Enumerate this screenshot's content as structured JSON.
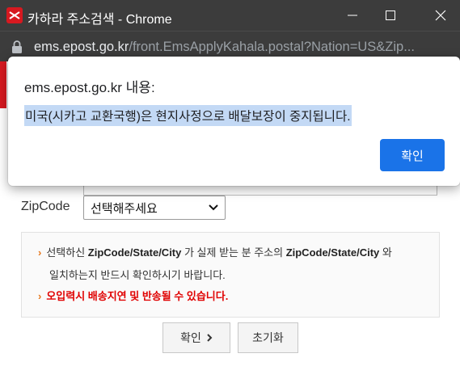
{
  "window": {
    "title": "카하라 주소검색 - Chrome",
    "icon": "ems-logo-icon"
  },
  "address_bar": {
    "host": "ems.epost.go.kr",
    "path": "/front.EmsApplyKahala.postal?Nation=US&Zip..."
  },
  "form": {
    "zip_label": "ZipCode",
    "zip_select_value": "선택해주세요"
  },
  "notice": {
    "line1_pre": "선택하신 ",
    "line1_bold1": "ZipCode/State/City",
    "line1_mid": " 가 실제 받는 분 주소의 ",
    "line1_bold2": "ZipCode/State/City",
    "line1_post": " 와",
    "line2": "일치하는지 반드시 확인하시기 바랍니다.",
    "line3": "오입력시 배송지연 및 반송될 수 있습니다."
  },
  "buttons": {
    "confirm": "확인",
    "reset": "초기화"
  },
  "dialog": {
    "title": "ems.epost.go.kr 내용:",
    "message": "미국(시카고 교환국행)은 현지사정으로 배달보장이 중지됩니다.",
    "ok": "확인"
  },
  "colors": {
    "chrome_bar": "#3c3c3c",
    "dialog_button": "#1a73e8",
    "selection_highlight": "#c3d9f5",
    "warning_red": "#e00000",
    "brand_red": "#d71920"
  }
}
